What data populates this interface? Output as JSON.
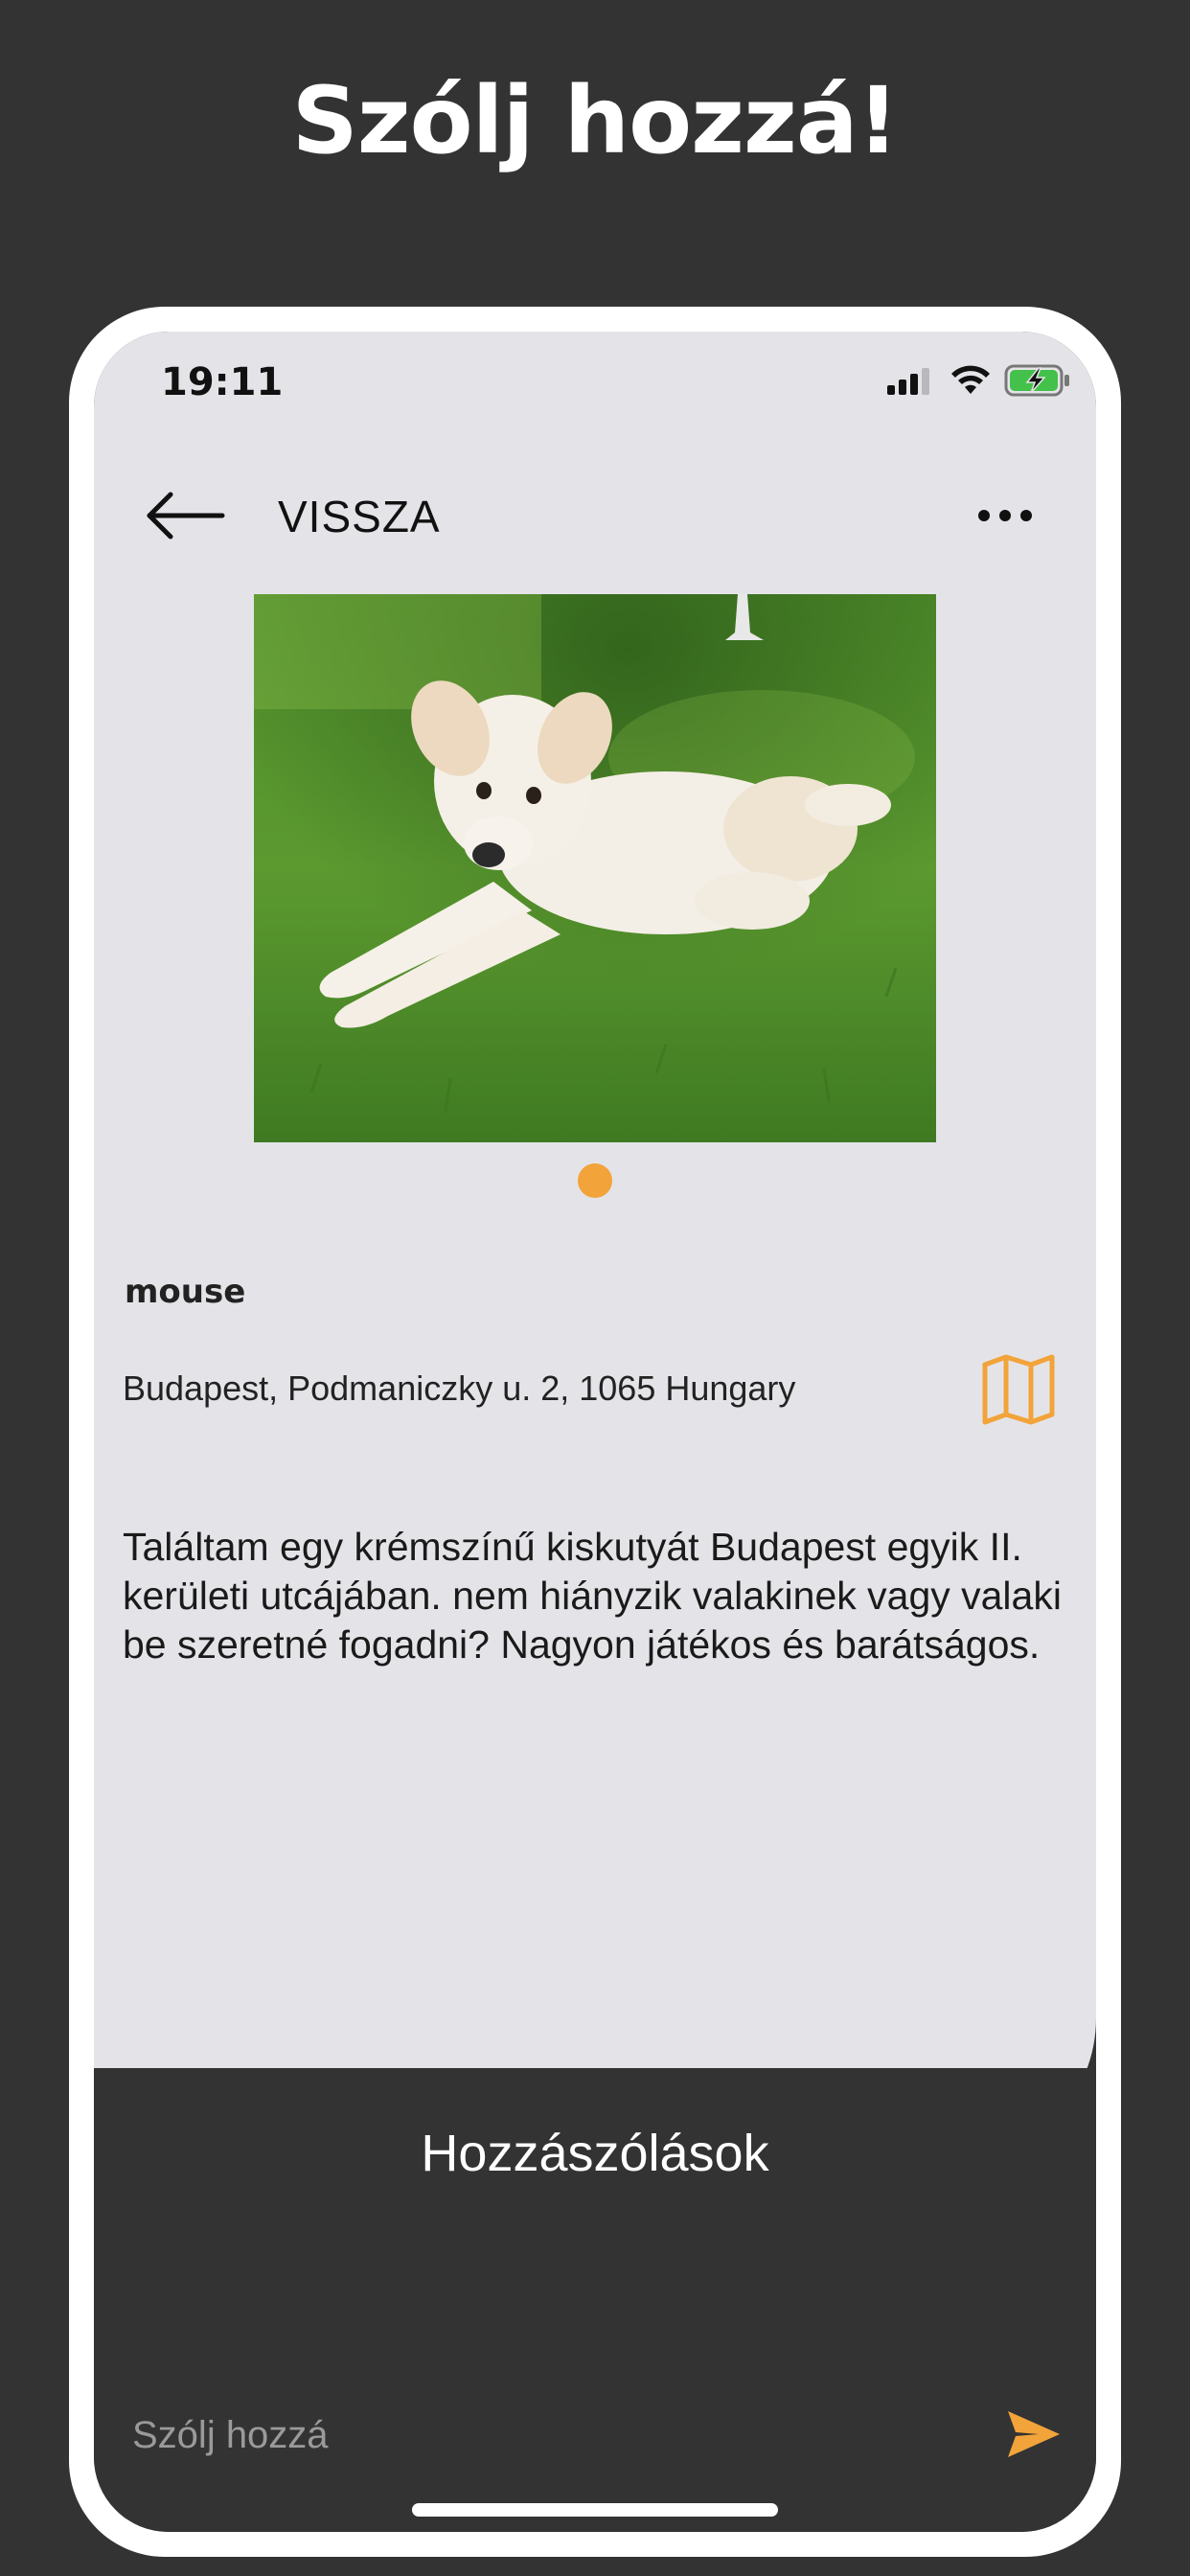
{
  "headline": "Szólj hozzá!",
  "status_bar": {
    "time": "19:11",
    "icons": [
      "signal-icon",
      "wifi-icon",
      "battery-charging-icon"
    ]
  },
  "nav": {
    "back_label": "VISSZA",
    "back_icon": "arrow-left-icon",
    "more_icon": "more-horizontal-icon"
  },
  "post": {
    "photo_subject": "cream-colored puppy lying on grass",
    "carousel": {
      "total": 1,
      "active": 1
    },
    "username": "mouse",
    "address": "Budapest, Podmaniczky u. 2, 1065 Hungary",
    "map_icon": "map-icon",
    "description": "Találtam egy krémszínű kiskutyát Budapest egyik II. kerületi utcájában. nem hiányzik valakinek vagy valaki be szeretné fogadni? Nagyon játékos és barátságos."
  },
  "comments": {
    "title": "Hozzászólások",
    "input_placeholder": "Szólj hozzá",
    "input_value": "",
    "send_icon": "send-icon"
  },
  "colors": {
    "background": "#333333",
    "light_surface": "#e4e4e8",
    "accent": "#f2a33a",
    "frame": "#ffffff"
  }
}
